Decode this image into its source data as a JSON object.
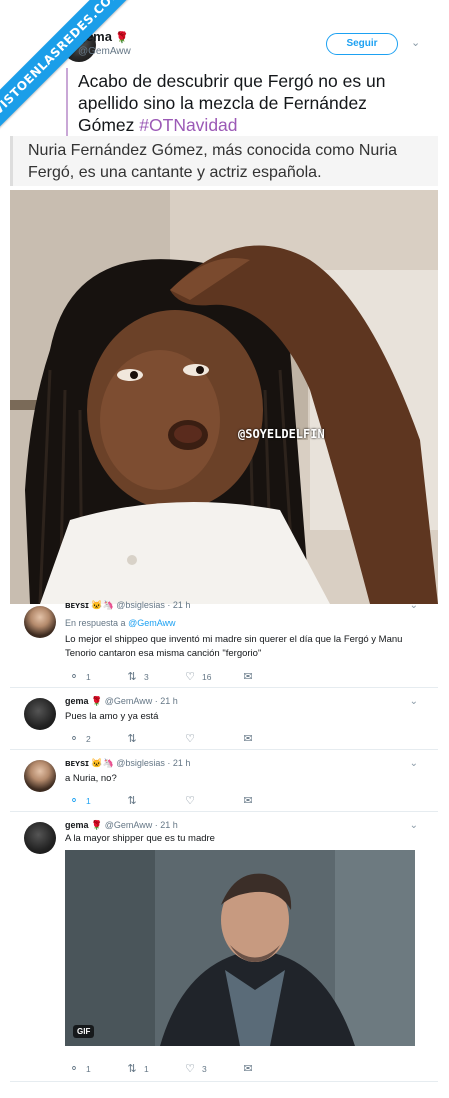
{
  "watermark_site": "VISTOENLASREDES.COM",
  "tweet": {
    "author_name": "gema",
    "author_emoji": "🌹",
    "author_handle": "@GemAww",
    "follow_label": "Seguir",
    "text_prefix": "Acabo de descubrir que Fergó no es un apellido sino la mezcla de Fernández Gómez ",
    "hashtag": "#OTNavidad",
    "quote_text": "Nuria Fernández Gómez, más conocida como Nuria Fergó, es una cantante y actriz española.",
    "image_watermark": "@SOYELDELFIN"
  },
  "replies": [
    {
      "name": "ʙᴇʏsɪ 🐱🦄",
      "handle": "@bsiglesias",
      "time": "21 h",
      "reply_to_prefix": "En respuesta a",
      "reply_to_handle": "@GemAww",
      "text": "Lo mejor el shippeo que inventó mi madre sin querer el día que la Fergó y Manu Tenorio cantaron esa misma canción \"fergorio\"",
      "replies": "1",
      "retweets": "3",
      "likes": "16"
    },
    {
      "name": "gema 🌹",
      "handle": "@GemAww",
      "time": "21 h",
      "text": "Pues la amo y ya está",
      "replies": "2",
      "retweets": "",
      "likes": ""
    },
    {
      "name": "ʙᴇʏsɪ 🐱🦄",
      "handle": "@bsiglesias",
      "time": "21 h",
      "text": "a Nuria, no?",
      "replies": "1",
      "retweets": "",
      "likes": ""
    },
    {
      "name": "gema 🌹",
      "handle": "@GemAww",
      "time": "21 h",
      "text": "A la mayor shipper que es tu madre",
      "gif_label": "GIF",
      "replies": "1",
      "retweets": "1",
      "likes": "3"
    }
  ],
  "icons": {
    "reply": "reply-icon",
    "retweet": "retweet-icon",
    "like": "heart-icon",
    "dm": "envelope-icon",
    "menu": "chevron-down-icon"
  },
  "colors": {
    "accent": "#1da1f2",
    "hashtag": "#9b59b6",
    "ribbon": "#1b9ee9"
  }
}
